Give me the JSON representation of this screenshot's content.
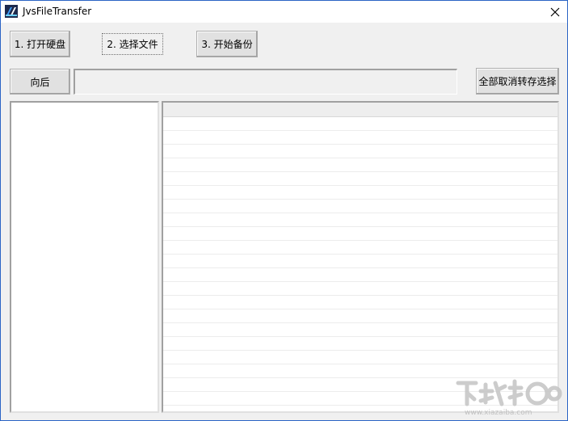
{
  "window": {
    "title": "JvsFileTransfer",
    "close_glyph": "✕"
  },
  "toolbar": {
    "step1_label": "1. 打开硬盘",
    "step2_label": "2. 选择文件",
    "step3_label": "3. 开始备份"
  },
  "nav": {
    "back_label": "向后",
    "path_value": "",
    "toggle_all_label": "全部取消转存选择"
  },
  "file_list": {
    "row_count": 21
  },
  "watermark": {
    "site": "www.xiazaiba.com"
  },
  "colors": {
    "window_border": "#2b64c5",
    "window_bg": "#f0f0f0",
    "button_bg": "#e1e1e1"
  }
}
